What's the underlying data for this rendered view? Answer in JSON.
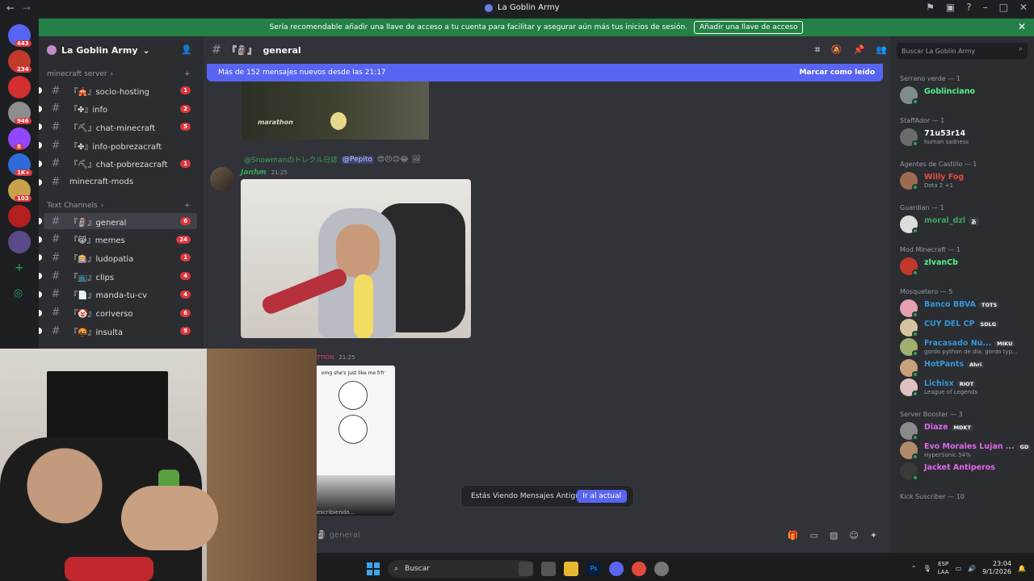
{
  "window": {
    "title": "La Goblin Army"
  },
  "banner": {
    "text": "Sería recomendable añadir una llave de acceso a tu cuenta para facilitar y asegurar aún más tus inicios de sesión.",
    "button": "Añadir una llave de acceso"
  },
  "guilds": [
    {
      "badge": "443",
      "color": "#5865f2"
    },
    {
      "badge": "234",
      "color": "#c0392b"
    },
    {
      "badge": "",
      "color": "#d32f2f"
    },
    {
      "badge": "946",
      "color": "#8e8e8e"
    },
    {
      "badge": "8",
      "color": "#9146ff"
    },
    {
      "badge": "1K+",
      "color": "#2e6bd8"
    },
    {
      "badge": "103",
      "color": "#c8a24a"
    },
    {
      "badge": "",
      "color": "#b31f1f"
    },
    {
      "badge": "",
      "color": "#5a4a8a"
    }
  ],
  "server": {
    "name": "La Goblin Army"
  },
  "categories": {
    "minecraft": "minecraft server",
    "text": "Text Channels"
  },
  "channels_minecraft": [
    {
      "name": "socio-hosting",
      "prefix": "『🎪』",
      "count": "1"
    },
    {
      "name": "info",
      "prefix": "『✤』",
      "count": "2"
    },
    {
      "name": "chat-minecraft",
      "prefix": "『⛏』",
      "count": "5"
    },
    {
      "name": "info-pobrezacraft",
      "prefix": "『✤』",
      "count": ""
    },
    {
      "name": "chat-pobrezacraft",
      "prefix": "『⛏』",
      "count": "1"
    },
    {
      "name": "minecraft-mods",
      "prefix": "",
      "count": ""
    }
  ],
  "channels_text": [
    {
      "name": "general",
      "prefix": "『🗿』",
      "count": "6"
    },
    {
      "name": "memes",
      "prefix": "『😹』",
      "count": "24"
    },
    {
      "name": "ludopatia",
      "prefix": "『🎰』",
      "count": "1"
    },
    {
      "name": "clips",
      "prefix": "『📺』",
      "count": "4"
    },
    {
      "name": "manda-tu-cv",
      "prefix": "『📄』",
      "count": "4"
    },
    {
      "name": "coriverso",
      "prefix": "『🤡』",
      "count": "6"
    },
    {
      "name": "insulta",
      "prefix": "『🤬』",
      "count": "9"
    }
  ],
  "channel": {
    "name": "general",
    "prefix": "『🗿』"
  },
  "newbar": {
    "text": "Más de 152 mensajes nuevos desde las 21:17",
    "mark": "Marcar como leído"
  },
  "message1": {
    "photo_text": "marathon"
  },
  "message2": {
    "reply_name": "@Snowmanのトレクル日誌",
    "reply_mention": "@Pepito",
    "author": "Janhm",
    "time": "21:25"
  },
  "message3": {
    "name": "TTION",
    "time": "21:25",
    "meme_text": "omg she's just like me frfr",
    "typing": "escribiendo..."
  },
  "old_messages": {
    "text": "Estás Viendo Mensajes Antiguos",
    "button": "Ir al actual"
  },
  "composer": {
    "placeholder": "general"
  },
  "members_search": {
    "placeholder": "Buscar La Goblin Army"
  },
  "roles": [
    {
      "title": "Serrano verde — 1",
      "members": [
        {
          "name": "Goblinciano",
          "color": "#57f287",
          "status": "",
          "tag": "",
          "avatar": "#7f8c8d"
        }
      ]
    },
    {
      "title": "StaffAdor — 1",
      "members": [
        {
          "name": "71u53r14",
          "color": "#f2f3f5",
          "status": "human sadness",
          "tag": "",
          "avatar": "#6b6b6b"
        }
      ]
    },
    {
      "title": "Agentes de Castillo — 1",
      "members": [
        {
          "name": "Willy Fog",
          "color": "#e74c3c",
          "status": "Dota 2 +1",
          "tag": "",
          "avatar": "#9c6b4f"
        }
      ]
    },
    {
      "title": "Guardian — 1",
      "members": [
        {
          "name": "moral_dzl",
          "color": "#3ba55c",
          "status": "",
          "tag": "あ",
          "avatar": "#dcdcdc"
        }
      ]
    },
    {
      "title": "Mod Minecraft — 1",
      "members": [
        {
          "name": "zlvanCb",
          "color": "#57f287",
          "status": "",
          "tag": "",
          "avatar": "#c0392b"
        }
      ]
    },
    {
      "title": "Mosquetero — 5",
      "members": [
        {
          "name": "Banco BBVA",
          "color": "#3498db",
          "status": "",
          "tag": "TOTS",
          "avatar": "#e6a0b0"
        },
        {
          "name": "CUY DEL CP",
          "color": "#3498db",
          "status": "",
          "tag": "SDLG",
          "avatar": "#d4c4a0"
        },
        {
          "name": "Fracasado Nu...",
          "color": "#3498db",
          "status": "gordo python de día, gordo typ...",
          "tag": "MIKU",
          "avatar": "#a0b070"
        },
        {
          "name": "HotPants",
          "color": "#3498db",
          "status": "",
          "tag": "Ahri",
          "avatar": "#c8a07a"
        },
        {
          "name": "Lichisx",
          "color": "#3498db",
          "status": "League of Legends",
          "tag": "RIOT",
          "avatar": "#e0c0c0"
        }
      ]
    },
    {
      "title": "Server Booster — 3",
      "members": [
        {
          "name": "Diaze",
          "color": "#e067f0",
          "status": "",
          "tag": "MDKT",
          "avatar": "#8a8a8a"
        },
        {
          "name": "Evo Morales Lujan ...",
          "color": "#e067f0",
          "status": "HyperSonic 54%",
          "tag": "GD",
          "avatar": "#b08a6a"
        },
        {
          "name": "Jacket Antiperos",
          "color": "#e067f0",
          "status": "",
          "tag": "",
          "avatar": "#3a3a3a"
        }
      ]
    },
    {
      "title": "Kick Suscriber — 10",
      "members": []
    }
  ],
  "taskbar": {
    "search": "Buscar",
    "lang1": "ESP",
    "lang2": "LAA",
    "time": "23:04",
    "date": "9/1/2026"
  }
}
